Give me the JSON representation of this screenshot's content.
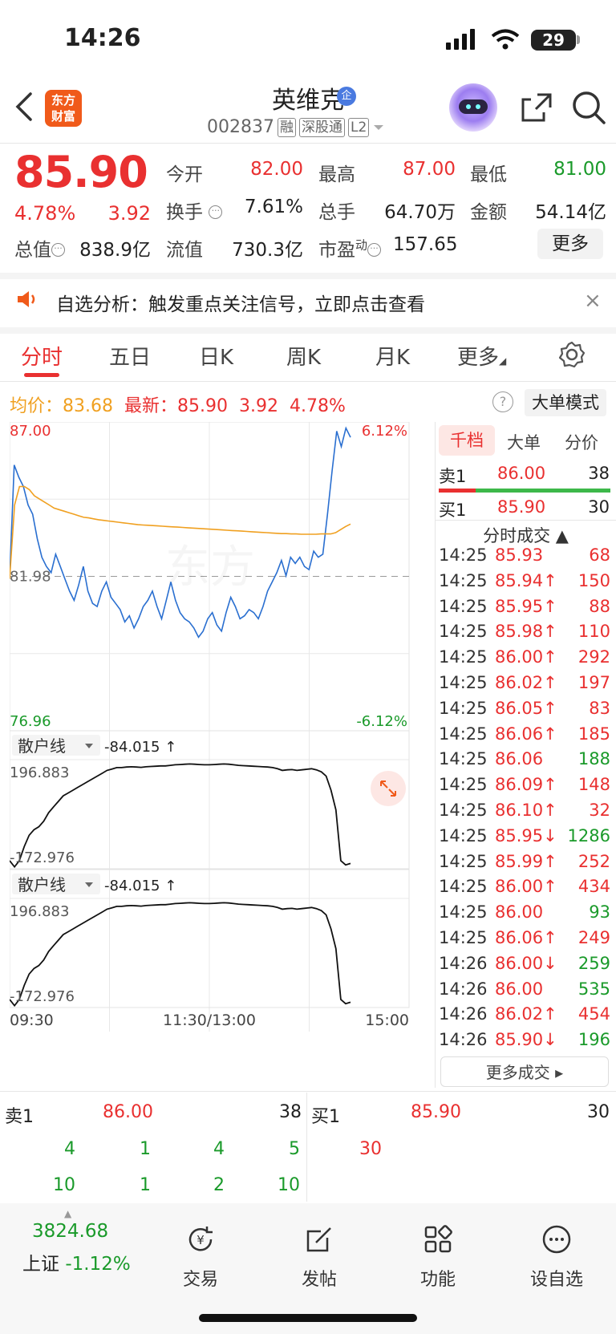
{
  "status_bar": {
    "time": "14:26",
    "battery": "29"
  },
  "header": {
    "logo_line1": "东方",
    "logo_line2": "财富",
    "stock_name": "英维克",
    "badge": "企",
    "code": "002837",
    "tags": [
      "融",
      "深股通",
      "L2"
    ]
  },
  "quote": {
    "price": "85.90",
    "change_pct": "4.78%",
    "change": "3.92",
    "open_label": "今开",
    "open": "82.00",
    "high_label": "最高",
    "high": "87.00",
    "low_label": "最低",
    "low": "81.00",
    "turnover_label": "换手",
    "turnover": "7.61%",
    "volume_label": "总手",
    "volume": "64.70万",
    "amount_label": "金额",
    "amount": "54.14亿",
    "mktcap_label": "总值",
    "mktcap": "838.9亿",
    "float_label": "流值",
    "float": "730.3亿",
    "pe_label": "市盈",
    "pe_sup": "动",
    "pe": "157.65",
    "more": "更多"
  },
  "banner": {
    "text": "自选分析：触发重点关注信号，立即点击查看",
    "close": "×"
  },
  "tabs": [
    "分时",
    "五日",
    "日K",
    "周K",
    "月K",
    "更多"
  ],
  "info": {
    "avg_label": "均价：",
    "avg": "83.68",
    "latest_label": "最新：",
    "latest": "85.90",
    "latest_chg": "3.92",
    "latest_pct": "4.78%",
    "help": "?",
    "mode": "大单模式"
  },
  "chart_data": {
    "type": "line",
    "ylim": [
      76.96,
      87.0
    ],
    "prev_close": "81.98",
    "y_top_label": "87.00",
    "y_bottom_label": "76.96",
    "pct_top_label": "6.12%",
    "pct_bottom_label": "-6.12%",
    "x_labels": [
      "09:30",
      "11:30/13:00",
      "15:00"
    ],
    "price": [
      81.9,
      85.6,
      85.2,
      84.9,
      84.3,
      84.0,
      83.2,
      82.6,
      82.3,
      82.1,
      82.7,
      82.3,
      81.9,
      81.5,
      81.2,
      81.7,
      82.3,
      81.5,
      81.1,
      81.0,
      81.5,
      81.8,
      81.3,
      81.1,
      80.9,
      80.5,
      80.7,
      80.3,
      80.6,
      81.0,
      81.2,
      81.5,
      81.0,
      80.6,
      81.2,
      81.8,
      81.2,
      80.8,
      80.6,
      80.5,
      80.3,
      80.0,
      80.2,
      80.6,
      80.8,
      80.4,
      80.2,
      80.8,
      81.3,
      81.0,
      80.6,
      80.7,
      80.9,
      80.8,
      80.6,
      81.0,
      81.5,
      81.8,
      82.1,
      82.5,
      82.0,
      82.6,
      82.4,
      82.6,
      82.3,
      82.2,
      82.8,
      82.6,
      82.7,
      84.0,
      85.4,
      86.7,
      86.2,
      86.8,
      86.5
    ],
    "avg": [
      81.9,
      84.3,
      84.9,
      84.9,
      84.8,
      84.6,
      84.5,
      84.4,
      84.3,
      84.2,
      84.15,
      84.1,
      84.05,
      84.0,
      83.95,
      83.9,
      83.88,
      83.85,
      83.82,
      83.8,
      83.78,
      83.76,
      83.74,
      83.72,
      83.7,
      83.68,
      83.66,
      83.65,
      83.64,
      83.63,
      83.62,
      83.61,
      83.6,
      83.59,
      83.58,
      83.57,
      83.56,
      83.55,
      83.54,
      83.53,
      83.52,
      83.51,
      83.5,
      83.49,
      83.48,
      83.47,
      83.46,
      83.45,
      83.44,
      83.43,
      83.42,
      83.41,
      83.4,
      83.39,
      83.38,
      83.37,
      83.37,
      83.36,
      83.36,
      83.35,
      83.35,
      83.35,
      83.35,
      83.36,
      83.36,
      83.36,
      83.4,
      83.5,
      83.6,
      83.68
    ],
    "sub_label": "散户线",
    "sub_value": "-84.015 ↑",
    "sub_top": "196.883",
    "sub_bottom": "-172.976",
    "sub_series": [
      -150,
      -172,
      -150,
      -100,
      -60,
      -40,
      -30,
      -10,
      20,
      40,
      60,
      80,
      90,
      100,
      110,
      120,
      130,
      140,
      150,
      160,
      170,
      175,
      180,
      180,
      182,
      183,
      182,
      181,
      183,
      184,
      185,
      186,
      186,
      188,
      190,
      191,
      192,
      193,
      192,
      191,
      190,
      190,
      191,
      192,
      193,
      192,
      190,
      188,
      187,
      186,
      185,
      184,
      183,
      182,
      180,
      176,
      170,
      172,
      173,
      170,
      172,
      174,
      176,
      172,
      165,
      150,
      100,
      30,
      -150,
      -165,
      -160
    ]
  },
  "order_panel": {
    "tabs": [
      "千档",
      "大单",
      "分价"
    ],
    "ask_label": "卖1",
    "ask_price": "86.00",
    "ask_vol": "38",
    "bid_label": "买1",
    "bid_price": "85.90",
    "bid_vol": "30",
    "section_title": "分时成交 ▲",
    "trades": [
      {
        "t": "14:25",
        "p": "85.93",
        "v": "68",
        "pc": "red",
        "vc": "red"
      },
      {
        "t": "14:25",
        "p": "85.94↑",
        "v": "150",
        "pc": "red",
        "vc": "red"
      },
      {
        "t": "14:25",
        "p": "85.95↑",
        "v": "88",
        "pc": "red",
        "vc": "red"
      },
      {
        "t": "14:25",
        "p": "85.98↑",
        "v": "110",
        "pc": "red",
        "vc": "red"
      },
      {
        "t": "14:25",
        "p": "86.00↑",
        "v": "292",
        "pc": "red",
        "vc": "red"
      },
      {
        "t": "14:25",
        "p": "86.02↑",
        "v": "197",
        "pc": "red",
        "vc": "red"
      },
      {
        "t": "14:25",
        "p": "86.05↑",
        "v": "83",
        "pc": "red",
        "vc": "red"
      },
      {
        "t": "14:25",
        "p": "86.06↑",
        "v": "185",
        "pc": "red",
        "vc": "red"
      },
      {
        "t": "14:25",
        "p": "86.06",
        "v": "188",
        "pc": "red",
        "vc": "green"
      },
      {
        "t": "14:25",
        "p": "86.09↑",
        "v": "148",
        "pc": "red",
        "vc": "red"
      },
      {
        "t": "14:25",
        "p": "86.10↑",
        "v": "32",
        "pc": "red",
        "vc": "red"
      },
      {
        "t": "14:25",
        "p": "85.95↓",
        "v": "1286",
        "pc": "red",
        "vc": "green"
      },
      {
        "t": "14:25",
        "p": "85.99↑",
        "v": "252",
        "pc": "red",
        "vc": "red"
      },
      {
        "t": "14:25",
        "p": "86.00↑",
        "v": "434",
        "pc": "red",
        "vc": "red"
      },
      {
        "t": "14:25",
        "p": "86.00",
        "v": "93",
        "pc": "red",
        "vc": "green"
      },
      {
        "t": "14:25",
        "p": "86.06↑",
        "v": "249",
        "pc": "red",
        "vc": "red"
      },
      {
        "t": "14:26",
        "p": "86.00↓",
        "v": "259",
        "pc": "red",
        "vc": "green"
      },
      {
        "t": "14:26",
        "p": "86.00",
        "v": "535",
        "pc": "red",
        "vc": "green"
      },
      {
        "t": "14:26",
        "p": "86.02↑",
        "v": "454",
        "pc": "red",
        "vc": "red"
      },
      {
        "t": "14:26",
        "p": "85.90↓",
        "v": "196",
        "pc": "red",
        "vc": "green"
      }
    ],
    "more_trades": "更多成交 ▸"
  },
  "bottom_book": {
    "ask_label": "卖1",
    "ask_price": "86.00",
    "ask_vol": "38",
    "bid_label": "买1",
    "bid_price": "85.90",
    "bid_vol": "30",
    "ask_queue_row1": [
      "4",
      "1",
      "4",
      "5"
    ],
    "ask_queue_row2": [
      "10",
      "1",
      "2",
      "10"
    ],
    "bid_queue": "30"
  },
  "bottom_nav": {
    "index_value": "3824.68",
    "index_name": "上证",
    "index_pct": "-1.12%",
    "items": [
      "交易",
      "发帖",
      "功能",
      "设自选"
    ]
  },
  "colors": {
    "up": "#e93030",
    "down": "#1a9a2a",
    "price_line": "#2a6fd0",
    "avg_line": "#f0a020"
  }
}
